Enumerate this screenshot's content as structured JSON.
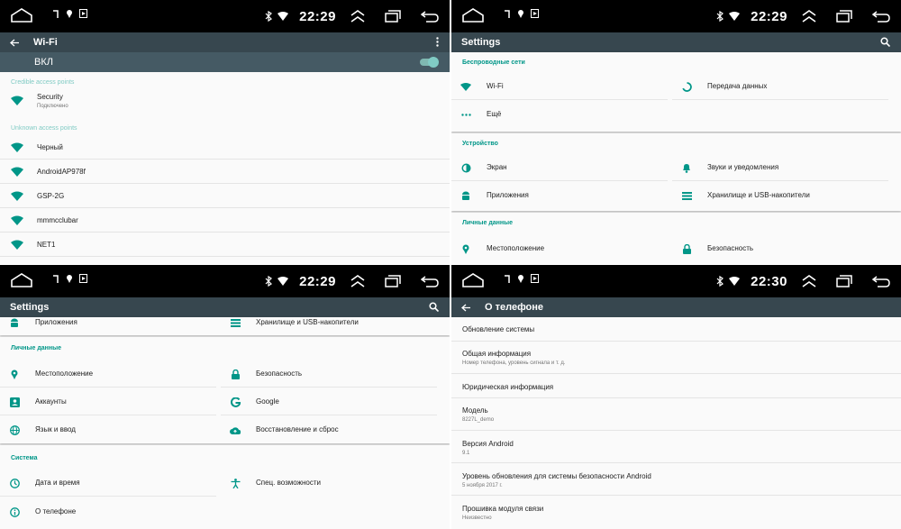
{
  "clock": {
    "p1": "22:29",
    "p2": "22:29",
    "p3": "22:29",
    "p4": "22:30"
  },
  "wifi": {
    "title": "Wi-Fi",
    "switch_label": "ВКЛ",
    "credible_header": "Credible access points",
    "credible": [
      {
        "name": "Security",
        "status": "Подключено"
      }
    ],
    "unknown_header": "Unknown access points",
    "unknown": [
      "Черный",
      "AndroidAP978f",
      "GSP-2G",
      "mmmcclubar",
      "NET1"
    ]
  },
  "settings": {
    "title": "Settings",
    "wireless_header": "Беспроводные сети",
    "wireless": [
      "Wi-Fi",
      "Передача данных",
      "Ещё"
    ],
    "device_header": "Устройство",
    "device": [
      "Экран",
      "Звуки и уведомления",
      "Приложения",
      "Хранилище и USB-накопители"
    ],
    "personal_header": "Личные данные",
    "personal": [
      "Местоположение",
      "Безопасность",
      "Аккаунты",
      "Google",
      "Язык и ввод",
      "Восстановление и сброс"
    ],
    "system_header": "Система",
    "system": [
      "Дата и время",
      "Спец. возможности",
      "О телефоне"
    ]
  },
  "about": {
    "title": "О телефоне",
    "items": [
      {
        "title": "Обновление системы",
        "sub": ""
      },
      {
        "title": "Общая информация",
        "sub": "Номер телефона, уровень сигнала и т. д."
      },
      {
        "title": "Юридическая информация",
        "sub": ""
      },
      {
        "title": "Модель",
        "sub": "8227L_demo"
      },
      {
        "title": "Версия Android",
        "sub": "9.1"
      },
      {
        "title": "Уровень обновления для системы безопасности Android",
        "sub": "5 ноября 2017 г."
      },
      {
        "title": "Прошивка модуля связи",
        "sub": "Неизвестно"
      }
    ]
  },
  "colors": {
    "accent": "#009688",
    "accent_light": "#80cbc4",
    "appbar": "#37474f",
    "switchbar": "#455a64",
    "statusbar": "#000000"
  },
  "icons": [
    "home-icon",
    "back-arrow-icon",
    "more-vert-icon",
    "search-icon",
    "bluetooth-icon",
    "wifi-icon",
    "eject-icon",
    "recent-apps-icon",
    "return-icon"
  ]
}
